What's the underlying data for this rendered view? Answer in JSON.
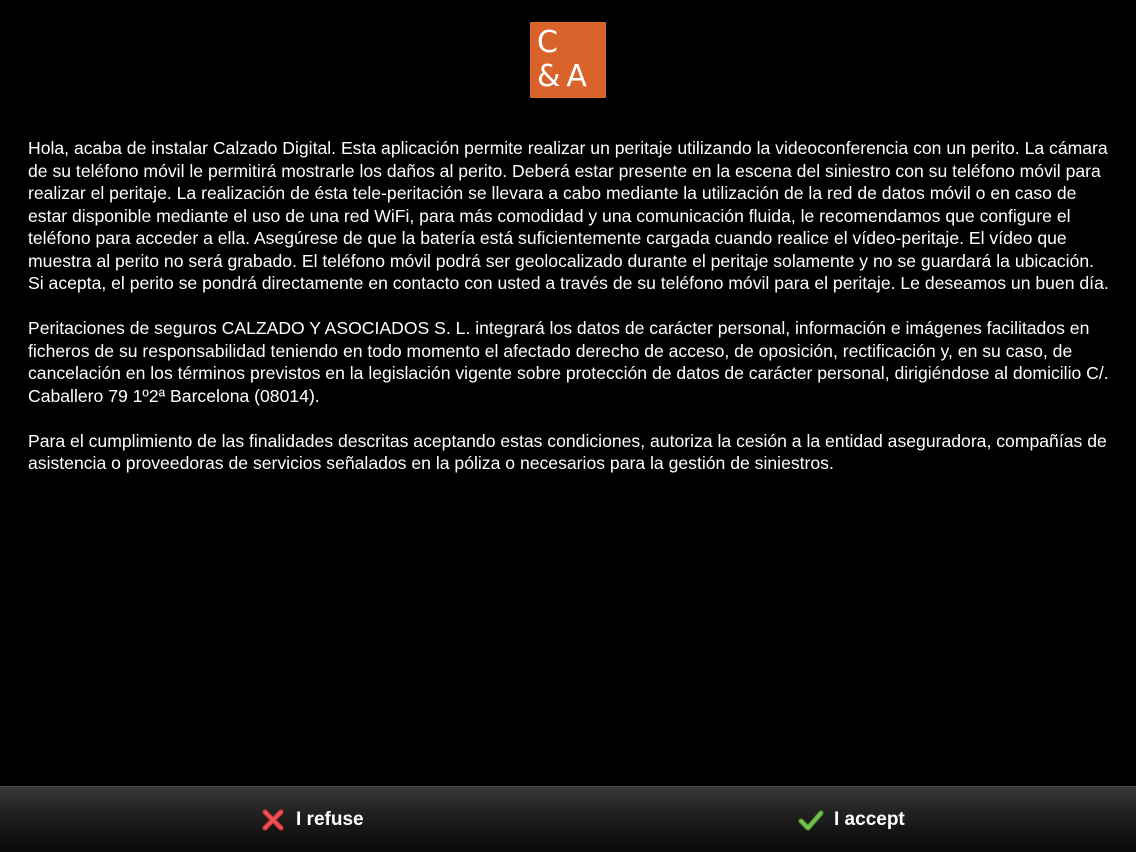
{
  "logo": {
    "line1": "C",
    "line2": "&A",
    "color": "#d9632a"
  },
  "paragraphs": [
    "Hola, acaba de instalar Calzado Digital. Esta aplicación permite realizar un peritaje utilizando la videoconferencia con un perito. La cámara de su teléfono móvil le permitirá mostrarle los daños al perito. Deberá estar presente en la escena del siniestro con su teléfono móvil para realizar el peritaje. La realización de ésta tele-peritación se llevara a cabo mediante la utilización de la red de datos móvil o en caso de estar disponible mediante el uso de una red WiFi, para más comodidad y una comunicación fluida, le recomendamos que configure el teléfono para acceder a ella. Asegúrese de que la batería está suficientemente cargada cuando realice el vídeo-peritaje. El vídeo que muestra al perito no será grabado. El teléfono móvil podrá ser geolocalizado durante el peritaje solamente y no se guardará la ubicación. Si acepta, el perito se pondrá directamente en contacto con usted a través de su teléfono móvil para el peritaje. Le deseamos un buen día.",
    "Peritaciones de seguros CALZADO Y ASOCIADOS S. L. integrará los datos de carácter personal, información e imágenes facilitados en ficheros de su responsabilidad teniendo en todo momento el afectado derecho de acceso, de oposición, rectificación y, en su caso, de cancelación en los términos previstos en la legislación vigente sobre protección de datos de carácter personal, dirigiéndose al domicilio C/. Caballero 79 1º2ª Barcelona (08014).",
    "Para el cumplimiento de las finalidades descritas aceptando estas condiciones, autoriza la cesión a la entidad aseguradora, compañías de asistencia o proveedoras de servicios señalados en la póliza o necesarios para la gestión de siniestros."
  ],
  "buttons": {
    "refuse": {
      "label": "I refuse",
      "icon": "close-icon",
      "color": "#e0393e"
    },
    "accept": {
      "label": "I accept",
      "icon": "checkmark-icon",
      "color": "#6cc04a"
    }
  }
}
